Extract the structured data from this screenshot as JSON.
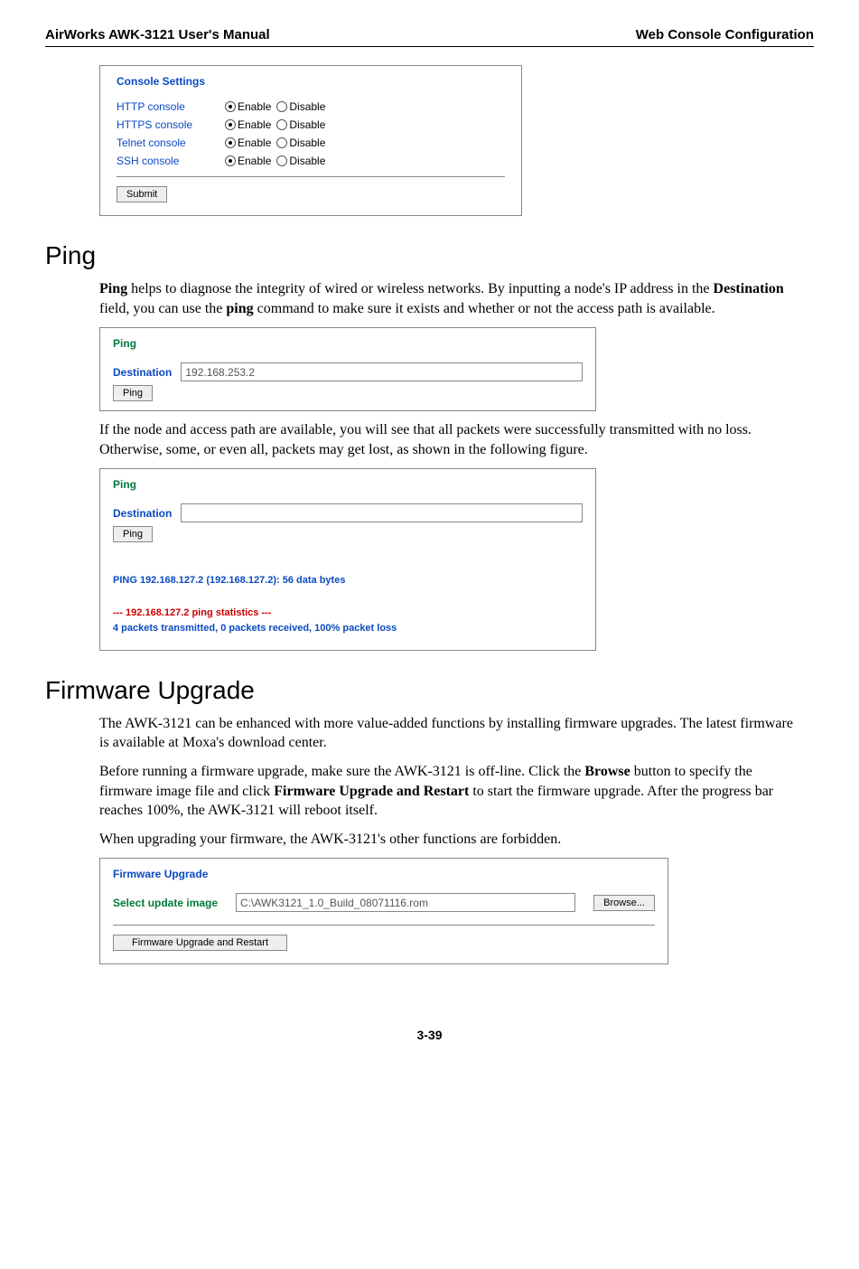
{
  "header": {
    "left": "AirWorks AWK-3121 User's Manual",
    "right": "Web Console Configuration"
  },
  "console": {
    "title": "Console Settings",
    "rows": [
      {
        "label": "HTTP console",
        "enable": "Enable",
        "disable": "Disable",
        "checked": "enable"
      },
      {
        "label": "HTTPS console",
        "enable": "Enable",
        "disable": "Disable",
        "checked": "enable"
      },
      {
        "label": "Telnet console",
        "enable": "Enable",
        "disable": "Disable",
        "checked": "enable"
      },
      {
        "label": "SSH console",
        "enable": "Enable",
        "disable": "Disable",
        "checked": "enable"
      }
    ],
    "submit": "Submit"
  },
  "ping_section": {
    "heading": "Ping",
    "intro_before_bold1": "Ping",
    "intro_rest1": " helps to diagnose the integrity of wired or wireless networks. By inputting a node's IP address in the ",
    "intro_bold2": "Destination",
    "intro_rest2": " field, you can use the ",
    "intro_bold3": "ping",
    "intro_rest3": " command to make sure it exists and whether or not the access path is available.",
    "ping_title": "Ping",
    "dest_label": "Destination",
    "dest_value": "192.168.253.2",
    "ping_btn": "Ping",
    "mid_para": "If the node and access path are available, you will see that all packets were successfully transmitted with no loss. Otherwise, some, or even all, packets may get lost, as shown in the following figure.",
    "result_line1": "PING 192.168.127.2 (192.168.127.2): 56 data bytes",
    "result_stats_prefix": "--- 192.168.127.2 ping statistics ---",
    "result_line2": "4 packets transmitted, 0 packets received, 100% packet loss"
  },
  "firmware_section": {
    "heading": "Firmware Upgrade",
    "para1": "The AWK-3121 can be enhanced with more value-added functions by installing firmware upgrades. The latest firmware is available at Moxa's download center.",
    "para2_before": "Before running a firmware upgrade, make sure the AWK-3121 is off-line. Click the ",
    "para2_b1": "Browse",
    "para2_mid": " button to specify the firmware image file and click ",
    "para2_b2": "Firmware Upgrade and Restart",
    "para2_after": " to start the firmware upgrade. After the progress bar reaches 100%, the AWK-3121 will reboot itself.",
    "para3": "When upgrading your firmware, the AWK-3121's other functions are forbidden.",
    "fw_title": "Firmware Upgrade",
    "fw_label": "Select update image",
    "fw_value": "C:\\AWK3121_1.0_Build_08071116.rom",
    "browse_btn": "Browse...",
    "upgrade_btn": "Firmware Upgrade and Restart"
  },
  "page_number": "3-39"
}
